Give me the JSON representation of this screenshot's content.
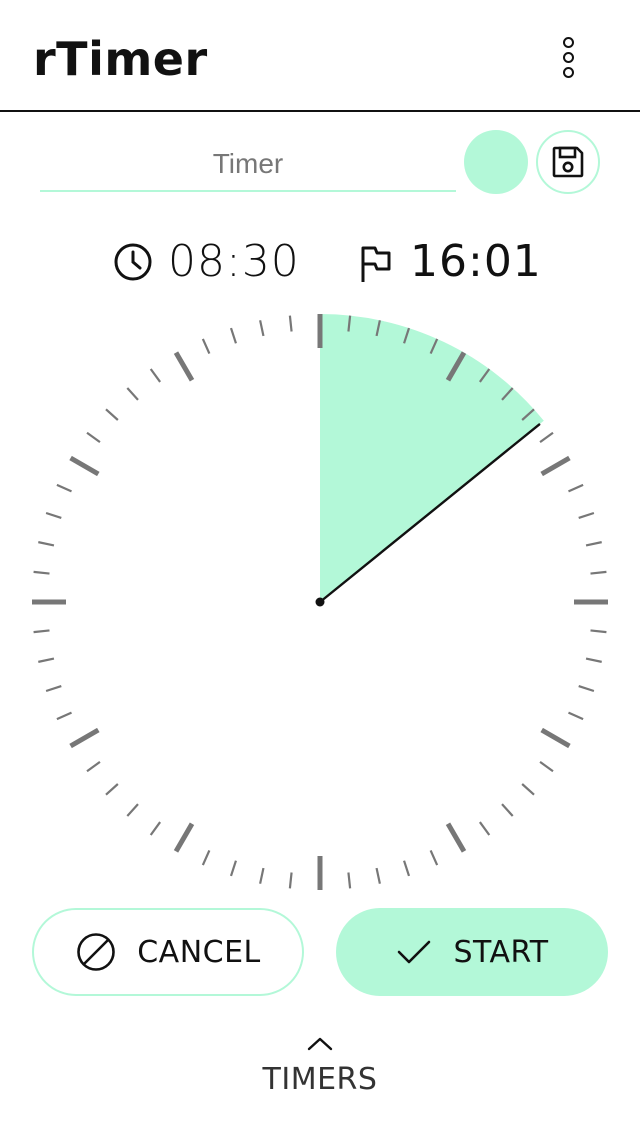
{
  "app": {
    "title": "rTimer"
  },
  "colors": {
    "accent": "#b3f8d8",
    "text": "#111111",
    "tick": "#777777"
  },
  "timer": {
    "name_placeholder": "Timer",
    "name_value": "",
    "duration": "08:30",
    "end_time": "16:01",
    "progress_minutes": 8.5,
    "dial_total_minutes": 60
  },
  "actions": {
    "cancel_label": "CANCEL",
    "start_label": "START"
  },
  "footer": {
    "timers_label": "TIMERS"
  },
  "icons": {
    "menu": "more-vertical-icon",
    "save": "floppy-disk-icon",
    "clock": "clock-icon",
    "end": "flag-icon",
    "cancel": "no-symbol-icon",
    "start": "check-icon",
    "expand": "chevron-up-icon"
  }
}
